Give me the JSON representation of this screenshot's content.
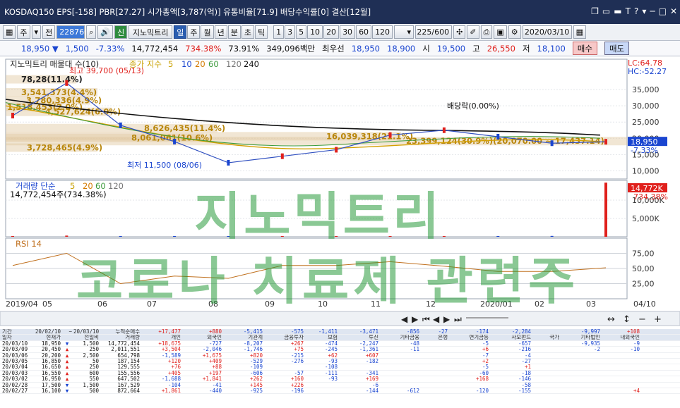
{
  "title": {
    "market": "KOSDAQ150",
    "eps": "EPS[-158]",
    "pbr": "PBR[27.27]",
    "mcap": "시가총액[3,787(억)]",
    "float": "유통비율[71.9]",
    "div": "배당수익률[0]",
    "settle": "결산[12월]",
    "win_icons": [
      "❐",
      "▭",
      "▬",
      "T",
      "?",
      "▾",
      "─",
      "□",
      "✕"
    ]
  },
  "toolbar": {
    "items": [
      "▦",
      "주",
      "▾",
      "전"
    ],
    "code": "228760",
    "search_icon": "⌕",
    "sound_icon": "🔊",
    "new_label": "신",
    "stock_name": "지노믹트리",
    "periods": [
      "일",
      "주",
      "월",
      "년",
      "분",
      "초",
      "틱"
    ],
    "active_period": "일",
    "intervals": [
      "1",
      "3",
      "5",
      "10",
      "20",
      "30",
      "60",
      "120"
    ],
    "count": "225",
    "count_total": "/600",
    "date": "2020/03/10"
  },
  "quote": {
    "price": "18,950",
    "arrow": "▼",
    "change": "1,500",
    "rate": "-7.33%",
    "volume": "14,772,454",
    "vol_rate": "734.38%",
    "turnover": "73.91%",
    "amount": "349,096백만",
    "best": "최우선",
    "ask": "18,950",
    "bid": "18,900",
    "open_label": "시",
    "open": "19,500",
    "high_label": "고",
    "high": "26,550",
    "low_label": "저",
    "low": "18,100",
    "buy": "매수",
    "sell": "매도"
  },
  "chart_labels": {
    "main_title": "지노믹트리 매물대 수(10)",
    "ma_label": "종가 지수",
    "ma_periods": [
      "5",
      "10",
      "20",
      "60",
      "120",
      "240"
    ],
    "high_note": "최고 39,700 (05/13)",
    "low_note": "최저 11,500 (08/06)",
    "div_note": "배당락(0.00%)",
    "lc": "LC:64.78",
    "hc": "HC:-52.27",
    "cur_price": "18,950",
    "cur_rate": "-7.33%",
    "vol_title": "거래량 단순",
    "vol_periods": [
      "5",
      "20",
      "60",
      "120"
    ],
    "vol_value": "14,772,454주(734.38%)",
    "vol_tag": "14,772K",
    "vol_tag_rate": "734.38%",
    "rsi_title": "RSI 14"
  },
  "volume_profile": [
    {
      "text": "78,28(11.4%)"
    },
    {
      "text": "3,541,373(4.4%)"
    },
    {
      "text": "3,780,336(4.9%)"
    },
    {
      "text": "1,518,453(2.0%)"
    },
    {
      "text": "4,527,624(6.0%)"
    },
    {
      "text": "8,626,435(11.4%)"
    },
    {
      "text": "8,061,061(10.6%)"
    },
    {
      "text": "3,728,465(4.9%)"
    },
    {
      "text": "16,039,318(21.1%)"
    },
    {
      "text": "23,399,124(30.9%)(20,070.00 ~ 17,437.14)"
    }
  ],
  "y_axis_price": [
    "35,000",
    "30,000",
    "25,000",
    "20,000",
    "15,000",
    "10,000"
  ],
  "y_axis_volume": [
    "10,000K",
    "5,000K"
  ],
  "y_axis_rsi": [
    "75,00",
    "50,00",
    "25,00"
  ],
  "x_axis": [
    "2019/04",
    "05",
    "06",
    "07",
    "08",
    "09",
    "10",
    "11",
    "12",
    "2020/01",
    "02",
    "03",
    "04/10"
  ],
  "watermark": {
    "line1": "지노믹트리",
    "line2": "코로나 치료제 관련주"
  },
  "chart_data": {
    "type": "line",
    "x": [
      "2019/04",
      "05",
      "06",
      "07",
      "08",
      "09",
      "10",
      "11",
      "12",
      "2020/01",
      "02",
      "03"
    ],
    "series": [
      {
        "name": "종가",
        "values": [
          27000,
          37000,
          24000,
          19000,
          12500,
          14500,
          16500,
          21000,
          22500,
          20500,
          18500,
          18950
        ]
      },
      {
        "name": "거래량",
        "values": [
          180,
          320,
          210,
          140,
          190,
          170,
          130,
          150,
          200,
          160,
          230,
          14772
        ]
      }
    ],
    "ylabel": "",
    "ylim": [
      7500,
      40000
    ]
  },
  "grid": {
    "header": [
      "일자",
      "현재가",
      "전일비",
      "거래량",
      "개인",
      "외국인",
      "기관계",
      "금융투자",
      "보험",
      "투신",
      "기타금융",
      "은행",
      "연기금등",
      "사모펀드",
      "국가",
      "기타법인",
      "내외국인"
    ],
    "summary": [
      "기간",
      "20/02/10",
      "~",
      "20/03/10",
      "누적순매수",
      "+17,477",
      "+880",
      "-5,415",
      "-575",
      "-1,411",
      "-3,471",
      "-856",
      "-27",
      "-174",
      "-2,284",
      "",
      "-9,997",
      "+108"
    ],
    "rows": [
      [
        "20/03/10",
        "18,950",
        "▼",
        "1,500",
        "14,772,454",
        "+18,675",
        "-727",
        "-8,207",
        "+267",
        "-474",
        "-2,247",
        "-48",
        "",
        "-5",
        "-657",
        "",
        "-9,935",
        "-9"
      ],
      [
        "20/03/09",
        "20,450",
        "▲",
        "250",
        "2,011,551",
        "+3,504",
        "-2,046",
        "-1,746",
        "+75",
        "-245",
        "-1,361",
        "-11",
        "",
        "+6",
        "-216",
        "",
        "-2",
        "-10"
      ],
      [
        "20/03/06",
        "20,200",
        "▲",
        "2,500",
        "654,798",
        "-1,589",
        "+1,675",
        "+820",
        "-215",
        "+62",
        "+607",
        "",
        "",
        "-7",
        "-4",
        "",
        "",
        ""
      ],
      [
        "20/03/05",
        "16,850",
        "▲",
        "50",
        "187,154",
        "+120",
        "+409",
        "-529",
        "-276",
        "-93",
        "-182",
        "",
        "",
        "+2",
        "-27",
        "",
        "",
        ""
      ],
      [
        "20/03/04",
        "16,650",
        "▲",
        "250",
        "129,555",
        "+76",
        "+88",
        "-109",
        "",
        "-108",
        "",
        "",
        "",
        "-5",
        "+1",
        "",
        "",
        ""
      ],
      [
        "20/03/03",
        "16,550",
        "▲",
        "600",
        "155,556",
        "+405",
        "+197",
        "-606",
        "-57",
        "-111",
        "-341",
        "",
        "",
        "-60",
        "-18",
        "",
        "",
        ""
      ],
      [
        "20/03/02",
        "16,950",
        "▲",
        "550",
        "647,502",
        "-1,688",
        "+1,841",
        "+262",
        "+160",
        "-93",
        "+169",
        "",
        "",
        "+168",
        "-146",
        "",
        "",
        ""
      ],
      [
        "20/02/28",
        "17,500",
        "▼",
        "1,500",
        "167,529",
        "-104",
        "-41",
        "+145",
        "+226",
        "",
        "-6",
        "",
        "",
        "",
        "-58",
        "",
        "",
        ""
      ],
      [
        "20/02/27",
        "16,100",
        "▼",
        "500",
        "872,664",
        "+1,861",
        "-440",
        "-925",
        "-196",
        "",
        "-144",
        "-612",
        "",
        "-120",
        "-155",
        "",
        "",
        "+4"
      ]
    ]
  }
}
